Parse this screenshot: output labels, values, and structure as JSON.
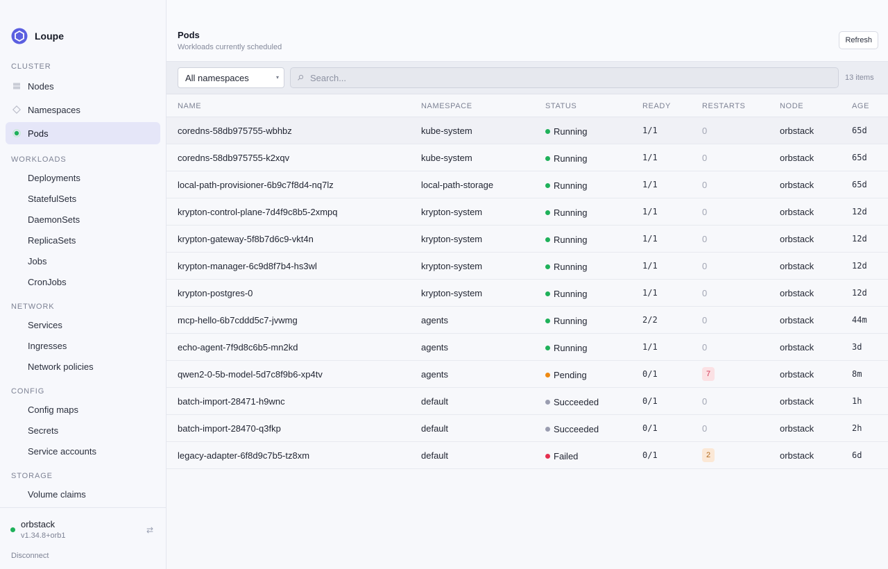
{
  "brand": {
    "name": "Loupe"
  },
  "sidebar": {
    "sections": {
      "cluster": "CLUSTER",
      "workloads": "WORKLOADS",
      "network": "NETWORK",
      "config": "CONFIG",
      "storage": "STORAGE"
    },
    "cluster_items": [
      {
        "label": "Nodes",
        "icon": "server-icon"
      },
      {
        "label": "Namespaces",
        "icon": "diamond-icon"
      },
      {
        "label": "Pods",
        "icon": "dot-icon",
        "active": true
      }
    ],
    "workloads_items": [
      "Deployments",
      "StatefulSets",
      "DaemonSets",
      "ReplicaSets",
      "Jobs",
      "CronJobs"
    ],
    "network_items": [
      "Services",
      "Ingresses",
      "Network policies"
    ],
    "config_items": [
      "Config maps",
      "Secrets",
      "Service accounts"
    ],
    "storage_items": [
      "Volume claims"
    ],
    "footer": {
      "context_name": "orbstack",
      "context_version": "v1.34.8+orb1",
      "disconnect_label": "Disconnect"
    }
  },
  "header": {
    "title": "Pods",
    "subtitle": "Workloads currently scheduled",
    "refresh_label": "Refresh"
  },
  "toolbar": {
    "namespace_selected": "All namespaces",
    "search_placeholder": "Search...",
    "item_count": "13 items"
  },
  "colors": {
    "running": "#1fb15a",
    "pending": "#ee8a13",
    "succeeded": "#9a9db0",
    "failed": "#e5304f"
  },
  "table": {
    "columns": [
      "NAME",
      "NAMESPACE",
      "STATUS",
      "READY",
      "RESTARTS",
      "NODE",
      "AGE"
    ],
    "rows": [
      {
        "name": "coredns-58db975755-wbhbz",
        "namespace": "kube-system",
        "status": "Running",
        "ready": "1/1",
        "restarts": "0",
        "node": "orbstack",
        "age": "65d"
      },
      {
        "name": "coredns-58db975755-k2xqv",
        "namespace": "kube-system",
        "status": "Running",
        "ready": "1/1",
        "restarts": "0",
        "node": "orbstack",
        "age": "65d"
      },
      {
        "name": "local-path-provisioner-6b9c7f8d4-nq7lz",
        "namespace": "local-path-storage",
        "status": "Running",
        "ready": "1/1",
        "restarts": "0",
        "node": "orbstack",
        "age": "65d"
      },
      {
        "name": "krypton-control-plane-7d4f9c8b5-2xmpq",
        "namespace": "krypton-system",
        "status": "Running",
        "ready": "1/1",
        "restarts": "0",
        "node": "orbstack",
        "age": "12d"
      },
      {
        "name": "krypton-gateway-5f8b7d6c9-vkt4n",
        "namespace": "krypton-system",
        "status": "Running",
        "ready": "1/1",
        "restarts": "0",
        "node": "orbstack",
        "age": "12d"
      },
      {
        "name": "krypton-manager-6c9d8f7b4-hs3wl",
        "namespace": "krypton-system",
        "status": "Running",
        "ready": "1/1",
        "restarts": "0",
        "node": "orbstack",
        "age": "12d"
      },
      {
        "name": "krypton-postgres-0",
        "namespace": "krypton-system",
        "status": "Running",
        "ready": "1/1",
        "restarts": "0",
        "node": "orbstack",
        "age": "12d"
      },
      {
        "name": "mcp-hello-6b7cddd5c7-jvwmg",
        "namespace": "agents",
        "status": "Running",
        "ready": "2/2",
        "restarts": "0",
        "node": "orbstack",
        "age": "44m"
      },
      {
        "name": "echo-agent-7f9d8c6b5-mn2kd",
        "namespace": "agents",
        "status": "Running",
        "ready": "1/1",
        "restarts": "0",
        "node": "orbstack",
        "age": "3d"
      },
      {
        "name": "qwen2-0-5b-model-5d7c8f9b6-xp4tv",
        "namespace": "agents",
        "status": "Pending",
        "ready": "0/1",
        "restarts": "7",
        "node": "orbstack",
        "age": "8m"
      },
      {
        "name": "batch-import-28471-h9wnc",
        "namespace": "default",
        "status": "Succeeded",
        "ready": "0/1",
        "restarts": "0",
        "node": "orbstack",
        "age": "1h"
      },
      {
        "name": "batch-import-28470-q3fkp",
        "namespace": "default",
        "status": "Succeeded",
        "ready": "0/1",
        "restarts": "0",
        "node": "orbstack",
        "age": "2h"
      },
      {
        "name": "legacy-adapter-6f8d9c7b5-tz8xm",
        "namespace": "default",
        "status": "Failed",
        "ready": "0/1",
        "restarts": "2",
        "node": "orbstack",
        "age": "6d"
      }
    ]
  }
}
